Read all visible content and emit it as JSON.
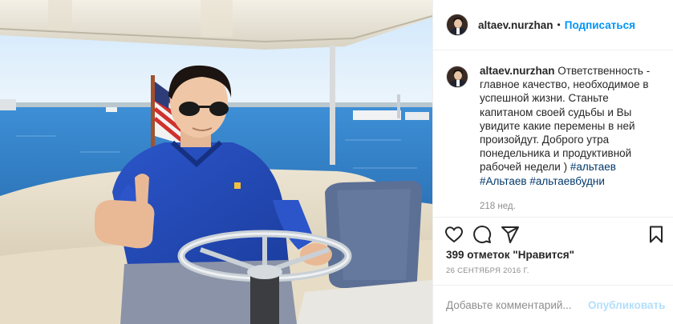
{
  "post": {
    "photo_alt": "",
    "author": {
      "username": "altaev.nurzhan",
      "separator": "•",
      "follow_label": "Подписаться"
    },
    "caption": {
      "username": "altaev.nurzhan",
      "text": "Ответственность - главное качество, необходимое в успешной жизни. Станьте капитаном своей судьбы и Вы увидите какие перемены в ней произойдут. Доброго утра понедельника и продуктивной рабочей недели )",
      "hashtags": [
        "#альтаев",
        "#Альтаев",
        "#альтаевбудни"
      ],
      "age": "218 нед."
    },
    "actions": {
      "like_icon": "heart-icon",
      "comment_icon": "comment-icon",
      "share_icon": "paper-plane-icon",
      "save_icon": "bookmark-icon"
    },
    "likes_text": "399 отметок \"Нравится\"",
    "date": "26 СЕНТЯБРЯ 2016 Г.",
    "comment": {
      "placeholder": "Добавьте комментарий...",
      "value": "",
      "publish_label": "Опубликовать"
    },
    "colors": {
      "accent": "#0095f6",
      "hashtag": "#00376b",
      "muted": "#8e8e8e",
      "publish_disabled": "#b2dffc"
    }
  }
}
